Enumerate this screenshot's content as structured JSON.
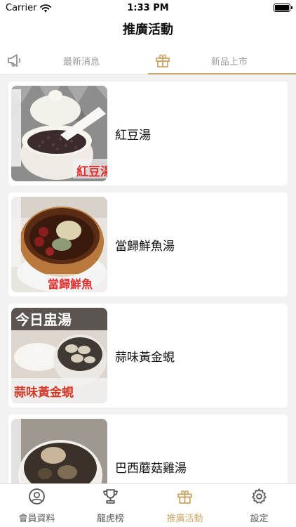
{
  "status_bar": {
    "carrier": "Carrier",
    "time": "1:33 PM"
  },
  "header": {
    "title": "推廣活動"
  },
  "tabs": [
    {
      "label": "最新消息",
      "icon": "megaphone-icon"
    },
    {
      "label": "新品上市",
      "icon": "gift-icon",
      "selected": true
    }
  ],
  "products": [
    {
      "name": "紅豆湯",
      "thumb_caption": "紅豆湯"
    },
    {
      "name": "當歸鮮魚湯",
      "thumb_caption": "當歸鮮魚"
    },
    {
      "name": "蒜味黃金蜆",
      "thumb_caption": "蒜味黃金蜆",
      "thumb_header": "今日盅湯"
    },
    {
      "name": "巴西蘑菇雞湯",
      "thumb_caption": ""
    }
  ],
  "bottom_tabs": [
    {
      "label": "會員資料",
      "icon": "user-icon"
    },
    {
      "label": "龍虎榜",
      "icon": "trophy-icon"
    },
    {
      "label": "推廣活動",
      "icon": "gift-icon",
      "active": true
    },
    {
      "label": "設定",
      "icon": "gear-icon"
    }
  ],
  "colors": {
    "accent": "#c8a86a",
    "inactive": "#999999"
  }
}
